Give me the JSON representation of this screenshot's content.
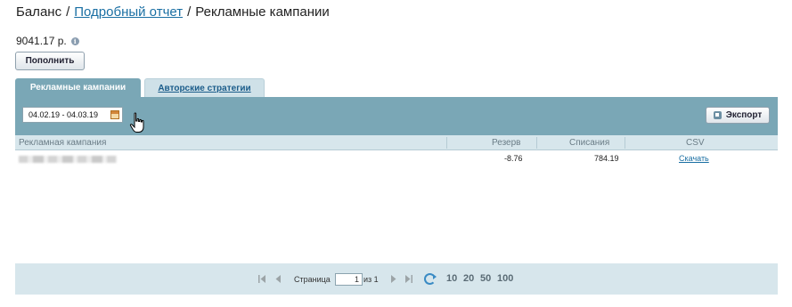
{
  "breadcrumb": {
    "root": "Баланс",
    "separator": "/",
    "detailed_report": "Подробный отчет",
    "current": "Рекламные кампании"
  },
  "balance": {
    "amount": "9041.17 р.",
    "info_icon": "i",
    "topup_label": "Пополнить"
  },
  "tabs": [
    {
      "label": "Рекламные кампании",
      "active": true
    },
    {
      "label": "Авторские стратегии",
      "active": false
    }
  ],
  "toolbar": {
    "date_range": "04.02.19 - 04.03.19",
    "export_label": "Экспорт"
  },
  "table": {
    "columns": [
      "Рекламная кампания",
      "Резерв",
      "Списания",
      "CSV"
    ],
    "rows": [
      {
        "campaign": "",
        "reserve": "-8.76",
        "charges": "784.19",
        "csv": "Скачать"
      }
    ]
  },
  "pager": {
    "page_label": "Страница",
    "page_value": "1",
    "of_label": "из 1",
    "page_sizes": [
      "10",
      "20",
      "50",
      "100"
    ]
  },
  "colors": {
    "accent": "#7aa7b6",
    "light_band": "#d7e6ec",
    "link": "#1a6fa3"
  }
}
